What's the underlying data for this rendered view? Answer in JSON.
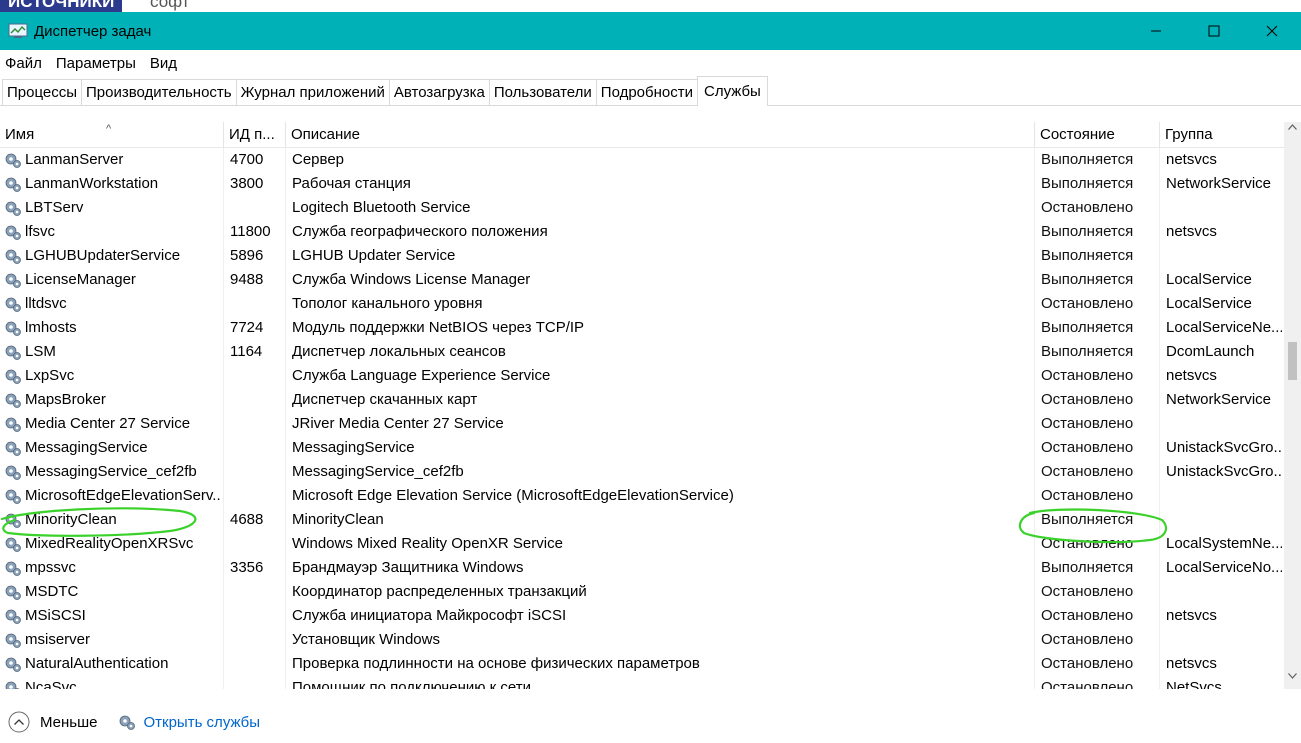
{
  "background_strip": {
    "left_text": "ИСТОЧНИКИ",
    "right_text": "софт"
  },
  "window": {
    "title": "Диспетчер задач"
  },
  "menu": [
    "Файл",
    "Параметры",
    "Вид"
  ],
  "tabs": [
    "Процессы",
    "Производительность",
    "Журнал приложений",
    "Автозагрузка",
    "Пользователи",
    "Подробности",
    "Службы"
  ],
  "active_tab": "Службы",
  "columns": {
    "name": "Имя",
    "pid": "ИД п...",
    "description": "Описание",
    "status": "Состояние",
    "group": "Группа"
  },
  "rows": [
    {
      "name": "LanmanServer",
      "pid": "4700",
      "description": "Сервер",
      "status": "Выполняется",
      "group": "netsvcs"
    },
    {
      "name": "LanmanWorkstation",
      "pid": "3800",
      "description": "Рабочая станция",
      "status": "Выполняется",
      "group": "NetworkService"
    },
    {
      "name": "LBTServ",
      "pid": "",
      "description": "Logitech Bluetooth Service",
      "status": "Остановлено",
      "group": ""
    },
    {
      "name": "lfsvc",
      "pid": "11800",
      "description": "Служба географического положения",
      "status": "Выполняется",
      "group": "netsvcs"
    },
    {
      "name": "LGHUBUpdaterService",
      "pid": "5896",
      "description": "LGHUB Updater Service",
      "status": "Выполняется",
      "group": ""
    },
    {
      "name": "LicenseManager",
      "pid": "9488",
      "description": "Служба Windows License Manager",
      "status": "Выполняется",
      "group": "LocalService"
    },
    {
      "name": "lltdsvc",
      "pid": "",
      "description": "Тополог канального уровня",
      "status": "Остановлено",
      "group": "LocalService"
    },
    {
      "name": "lmhosts",
      "pid": "7724",
      "description": "Модуль поддержки NetBIOS через TCP/IP",
      "status": "Выполняется",
      "group": "LocalServiceNe..."
    },
    {
      "name": "LSM",
      "pid": "1164",
      "description": "Диспетчер локальных сеансов",
      "status": "Выполняется",
      "group": "DcomLaunch"
    },
    {
      "name": "LxpSvc",
      "pid": "",
      "description": "Служба Language Experience Service",
      "status": "Остановлено",
      "group": "netsvcs"
    },
    {
      "name": "MapsBroker",
      "pid": "",
      "description": "Диспетчер скачанных карт",
      "status": "Остановлено",
      "group": "NetworkService"
    },
    {
      "name": "Media Center 27 Service",
      "pid": "",
      "description": "JRiver Media Center 27 Service",
      "status": "Остановлено",
      "group": ""
    },
    {
      "name": "MessagingService",
      "pid": "",
      "description": "MessagingService",
      "status": "Остановлено",
      "group": "UnistackSvcGro..."
    },
    {
      "name": "MessagingService_cef2fb",
      "pid": "",
      "description": "MessagingService_cef2fb",
      "status": "Остановлено",
      "group": "UnistackSvcGro..."
    },
    {
      "name": "MicrosoftEdgeElevationServ...",
      "pid": "",
      "description": "Microsoft Edge Elevation Service (MicrosoftEdgeElevationService)",
      "status": "Остановлено",
      "group": ""
    },
    {
      "name": "MinorityClean",
      "pid": "4688",
      "description": "MinorityClean",
      "status": "Выполняется",
      "group": ""
    },
    {
      "name": "MixedRealityOpenXRSvc",
      "pid": "",
      "description": "Windows Mixed Reality OpenXR Service",
      "status": "Остановлено",
      "group": "LocalSystemNe..."
    },
    {
      "name": "mpssvc",
      "pid": "3356",
      "description": "Брандмауэр Защитника Windows",
      "status": "Выполняется",
      "group": "LocalServiceNo..."
    },
    {
      "name": "MSDTC",
      "pid": "",
      "description": "Координатор распределенных транзакций",
      "status": "Остановлено",
      "group": ""
    },
    {
      "name": "MSiSCSI",
      "pid": "",
      "description": "Служба инициатора Майкрософт iSCSI",
      "status": "Остановлено",
      "group": "netsvcs"
    },
    {
      "name": "msiserver",
      "pid": "",
      "description": "Установщик Windows",
      "status": "Остановлено",
      "group": ""
    },
    {
      "name": "NaturalAuthentication",
      "pid": "",
      "description": "Проверка подлинности на основе физических параметров",
      "status": "Остановлено",
      "group": "netsvcs"
    },
    {
      "name": "NcaSvc",
      "pid": "",
      "description": "Помощник по подключению к сети",
      "status": "Остановлено",
      "group": "NetSvcs"
    }
  ],
  "footer": {
    "fewer_label": "Меньше",
    "open_services_label": "Открыть службы"
  },
  "colors": {
    "titlebar": "#00b2b7",
    "link": "#0066cc",
    "annotation": "#3ad12b"
  },
  "icons": [
    "app-icon",
    "minimize-icon",
    "maximize-icon",
    "close-icon",
    "service-gear-icon",
    "chevron-up-icon",
    "sort-caret-icon"
  ]
}
